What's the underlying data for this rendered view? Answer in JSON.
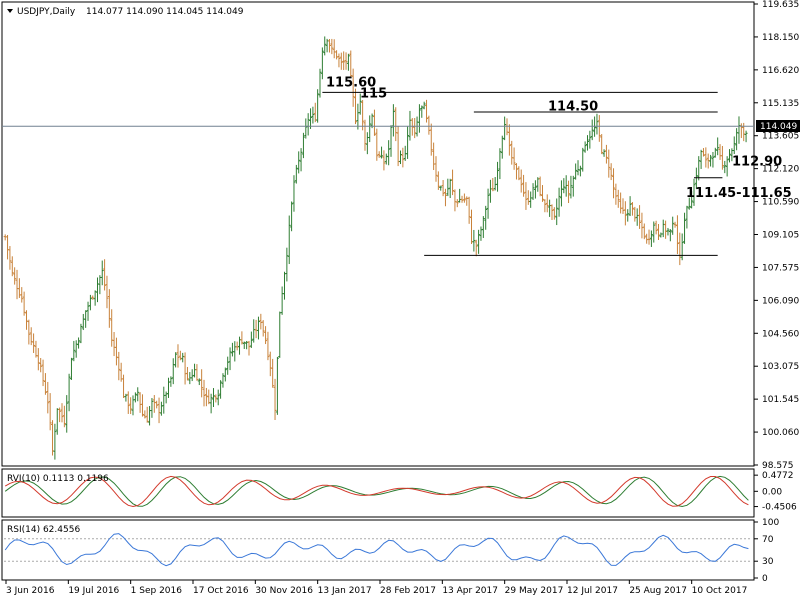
{
  "chart_data": [
    {
      "type": "ohlc",
      "instrument": "USDJPY",
      "timeframe": "Daily",
      "header": {
        "symbol_label": "USDJPY,Daily",
        "ohlc_text": "114.077 114.090 114.045 114.049"
      },
      "last_price": 114.049,
      "last_price_label": "114.049",
      "ylim": [
        98.575,
        119.635
      ],
      "y_tick_labels": [
        "119.635",
        "118.150",
        "116.620",
        "115.135",
        "113.605",
        "112.120",
        "110.590",
        "109.105",
        "107.575",
        "106.090",
        "104.560",
        "103.075",
        "101.545",
        "100.060",
        "98.575"
      ],
      "x_tick_labels": [
        "3 Jun 2016",
        "19 Jul 2016",
        "1 Sep 2016",
        "17 Oct 2016",
        "30 Nov 2016",
        "13 Jan 2017",
        "28 Feb 2017",
        "13 Apr 2017",
        "29 May 2017",
        "12 Jul 2017",
        "25 Aug 2017",
        "10 Oct 2017"
      ],
      "colors": {
        "up": "#2e7d32",
        "down": "#c8823a",
        "grid": "#d8d8d8",
        "last_line": "#708090"
      },
      "price_path": [
        [
          0,
          109.0
        ],
        [
          3,
          107.3
        ],
        [
          7,
          106.2
        ],
        [
          10,
          104.6
        ],
        [
          14,
          103.4
        ],
        [
          18,
          101.5
        ],
        [
          20,
          99.2
        ],
        [
          22,
          101.2
        ],
        [
          25,
          100.6
        ],
        [
          28,
          103.5
        ],
        [
          31,
          104.4
        ],
        [
          34,
          105.6
        ],
        [
          38,
          106.6
        ],
        [
          41,
          107.4
        ],
        [
          43,
          106.2
        ],
        [
          45,
          104.3
        ],
        [
          48,
          103.1
        ],
        [
          50,
          101.8
        ],
        [
          53,
          101.2
        ],
        [
          56,
          101.9
        ],
        [
          58,
          100.9
        ],
        [
          60,
          100.7
        ],
        [
          62,
          101.4
        ],
        [
          65,
          101.1
        ],
        [
          67,
          101.6
        ],
        [
          70,
          102.5
        ],
        [
          72,
          103.6
        ],
        [
          75,
          103.4
        ],
        [
          77,
          102.4
        ],
        [
          80,
          102.9
        ],
        [
          82,
          102.4
        ],
        [
          85,
          101.6
        ],
        [
          87,
          101.6
        ],
        [
          90,
          101.9
        ],
        [
          92,
          102.8
        ],
        [
          95,
          103.6
        ],
        [
          98,
          104.1
        ],
        [
          100,
          104.3
        ],
        [
          103,
          104.0
        ],
        [
          105,
          104.6
        ],
        [
          108,
          105.2
        ],
        [
          110,
          104.3
        ],
        [
          112,
          103.1
        ],
        [
          114,
          101.2
        ],
        [
          116,
          105.6
        ],
        [
          119,
          108.3
        ],
        [
          122,
          111.5
        ],
        [
          125,
          112.9
        ],
        [
          128,
          114.4
        ],
        [
          131,
          114.5
        ],
        [
          134,
          117.6
        ],
        [
          136,
          118.1
        ],
        [
          138,
          117.5
        ],
        [
          140,
          117.3
        ],
        [
          142,
          116.9
        ],
        [
          145,
          117.1
        ],
        [
          148,
          114.4
        ],
        [
          150,
          115.2
        ],
        [
          152,
          113.2
        ],
        [
          155,
          114.6
        ],
        [
          157,
          112.8
        ],
        [
          160,
          112.4
        ],
        [
          162,
          113.0
        ],
        [
          164,
          114.8
        ],
        [
          166,
          112.6
        ],
        [
          169,
          112.7
        ],
        [
          171,
          114.3
        ],
        [
          173,
          113.6
        ],
        [
          175,
          114.8
        ],
        [
          177,
          114.9
        ],
        [
          179,
          113.7
        ],
        [
          181,
          112.4
        ],
        [
          183,
          111.4
        ],
        [
          186,
          110.9
        ],
        [
          188,
          111.5
        ],
        [
          190,
          110.6
        ],
        [
          192,
          110.7
        ],
        [
          195,
          110.7
        ],
        [
          197,
          108.9
        ],
        [
          199,
          108.6
        ],
        [
          202,
          109.7
        ],
        [
          204,
          110.9
        ],
        [
          207,
          111.4
        ],
        [
          209,
          113.0
        ],
        [
          211,
          114.3
        ],
        [
          213,
          113.0
        ],
        [
          215,
          112.2
        ],
        [
          218,
          111.5
        ],
        [
          220,
          110.6
        ],
        [
          222,
          110.9
        ],
        [
          225,
          111.5
        ],
        [
          227,
          110.6
        ],
        [
          229,
          110.5
        ],
        [
          232,
          109.8
        ],
        [
          234,
          110.8
        ],
        [
          236,
          111.4
        ],
        [
          238,
          111.0
        ],
        [
          241,
          112.0
        ],
        [
          243,
          112.3
        ],
        [
          245,
          113.3
        ],
        [
          248,
          113.8
        ],
        [
          250,
          114.1
        ],
        [
          252,
          113.0
        ],
        [
          255,
          112.3
        ],
        [
          257,
          111.2
        ],
        [
          260,
          110.2
        ],
        [
          262,
          110.0
        ],
        [
          264,
          110.4
        ],
        [
          267,
          109.8
        ],
        [
          269,
          109.4
        ],
        [
          271,
          108.8
        ],
        [
          274,
          109.5
        ],
        [
          276,
          109.2
        ],
        [
          278,
          109.4
        ],
        [
          281,
          109.2
        ],
        [
          283,
          109.7
        ],
        [
          285,
          107.9
        ],
        [
          287,
          109.9
        ],
        [
          290,
          110.8
        ],
        [
          292,
          111.9
        ],
        [
          294,
          112.9
        ],
        [
          296,
          112.4
        ],
        [
          299,
          112.8
        ],
        [
          301,
          112.9
        ],
        [
          303,
          112.2
        ],
        [
          306,
          112.8
        ],
        [
          308,
          113.2
        ],
        [
          310,
          114.1
        ],
        [
          312,
          113.7
        ],
        [
          314,
          114.049
        ]
      ],
      "annotations": [
        {
          "text": "115.60",
          "price": 115.6
        },
        {
          "text": "115",
          "price": 115.0
        },
        {
          "text": "114.50",
          "price": 114.5
        },
        {
          "text": "112.90",
          "price": 112.9
        },
        {
          "text": "111.45-111.65",
          "price": 111.55
        }
      ],
      "horizontal_lines": [
        {
          "price": 115.6,
          "from_index": 134,
          "to_index": 301
        },
        {
          "price": 114.7,
          "from_index": 198,
          "to_index": 301
        },
        {
          "price": 111.7,
          "from_index": 291,
          "to_index": 303
        },
        {
          "price": 108.15,
          "from_index": 177,
          "to_index": 301
        }
      ]
    },
    {
      "type": "line",
      "indicator": "RVI(10)",
      "header": {
        "label": "RVI(10) 0.1113 0.1196"
      },
      "values": [
        0.1113,
        0.1196
      ],
      "ylim": [
        -0.7,
        0.6
      ],
      "y_tick_labels": [
        "0.4772",
        "0.00",
        "-0.4506"
      ],
      "series": [
        {
          "color": "#2e7d32"
        },
        {
          "color": "#d33a2c"
        }
      ]
    },
    {
      "type": "line",
      "indicator": "RSI(14)",
      "header": {
        "label": "RSI(14) 62.4556"
      },
      "value": 62.4556,
      "ylim": [
        0,
        100
      ],
      "levels": [
        30,
        70
      ],
      "y_tick_labels": [
        "100",
        "70",
        "30",
        "0"
      ],
      "series": [
        {
          "color": "#3b78d8"
        }
      ]
    }
  ]
}
